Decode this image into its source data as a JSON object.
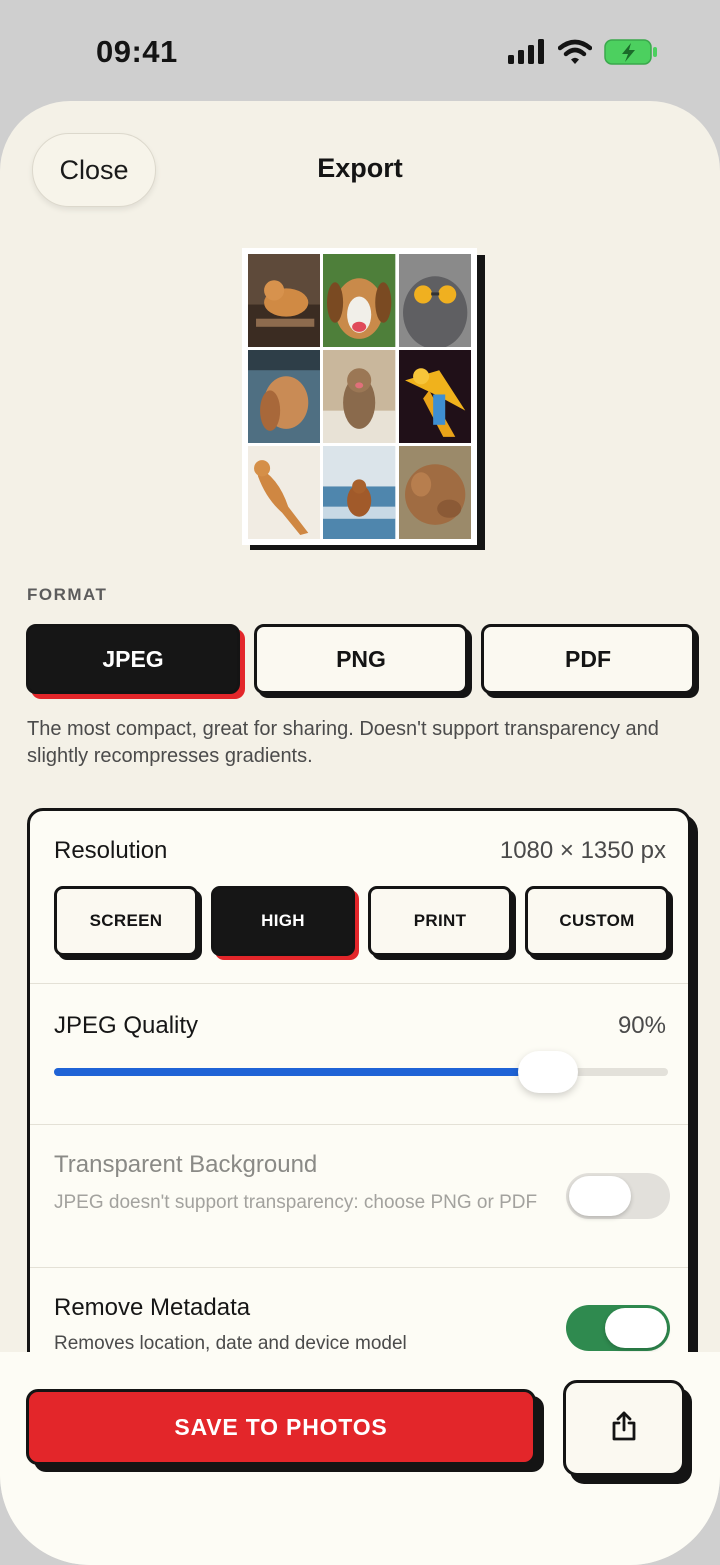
{
  "status": {
    "time": "09:41"
  },
  "header": {
    "close_label": "Close",
    "title": "Export"
  },
  "preview": {
    "tiles": [
      "cat-lounging",
      "beagle-dog",
      "cat-with-sunglasses",
      "spaniel-dog",
      "kitten-meowing",
      "parrot",
      "cat-stretching",
      "dog-running-beach",
      "cat-playing"
    ]
  },
  "format": {
    "section_label": "FORMAT",
    "options": [
      "JPEG",
      "PNG",
      "PDF"
    ],
    "selected": "JPEG",
    "description": "The most compact, great for sharing. Doesn't support transparency and slightly recompresses gradients."
  },
  "resolution": {
    "label": "Resolution",
    "value": "1080 × 1350 px",
    "options": [
      "SCREEN",
      "HIGH",
      "PRINT",
      "CUSTOM"
    ],
    "selected": "HIGH"
  },
  "quality": {
    "label": "JPEG Quality",
    "value": "90%",
    "fraction": 0.9
  },
  "transparent": {
    "label": "Transparent Background",
    "sub": "JPEG doesn't support transparency: choose PNG or PDF",
    "enabled": false,
    "disabled": true
  },
  "metadata": {
    "label": "Remove Metadata",
    "sub": "Removes location, date and device model",
    "enabled": true
  },
  "actions": {
    "save_label": "SAVE TO PHOTOS"
  },
  "colors": {
    "accent": "#e3262a",
    "slider": "#1f63d6",
    "toggle_on": "#2f8a4f",
    "ink": "#141414",
    "sheet": "#f4f1e7"
  }
}
